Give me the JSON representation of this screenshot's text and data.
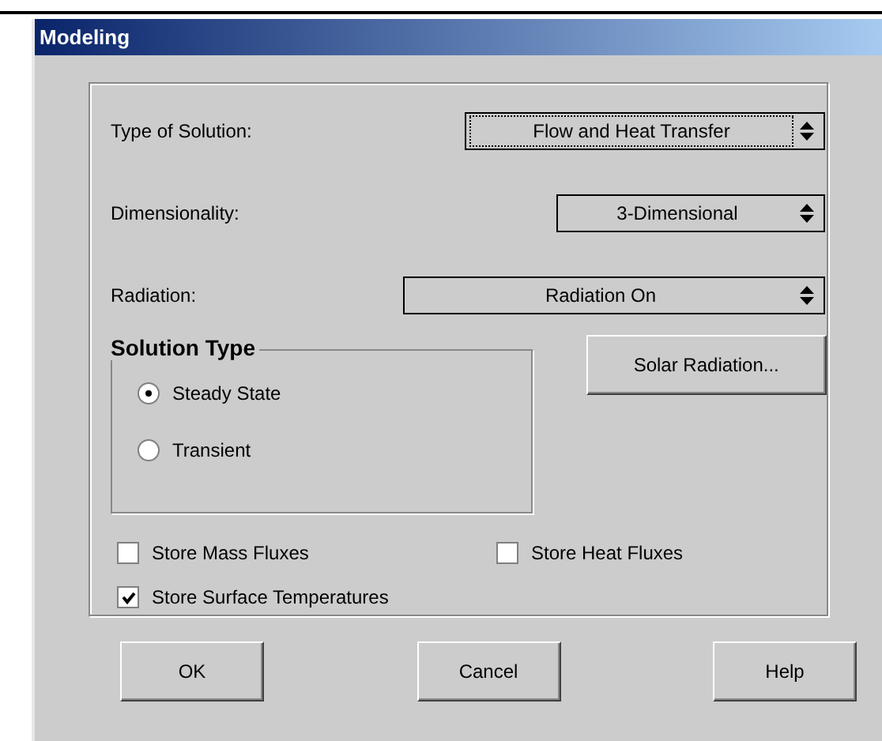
{
  "window": {
    "title": "Modeling"
  },
  "dropdowns": [
    {
      "label": "Type of Solution:",
      "value": "Flow and Heat Transfer",
      "focused": true
    },
    {
      "label": "Dimensionality:",
      "value": "3-Dimensional",
      "focused": false
    },
    {
      "label": "Radiation:",
      "value": "Radiation On",
      "focused": false
    }
  ],
  "solution_type": {
    "title": "Solution Type",
    "options": [
      {
        "label": "Steady State",
        "selected": true
      },
      {
        "label": "Transient",
        "selected": false
      }
    ]
  },
  "side_button": "Solar Radiation...",
  "checkboxes": [
    {
      "label": "Store Mass Fluxes",
      "checked": false
    },
    {
      "label": "Store Heat Fluxes",
      "checked": false
    },
    {
      "label": "Store Surface Temperatures",
      "checked": true
    }
  ],
  "buttons": [
    "OK",
    "Cancel",
    "Help"
  ]
}
